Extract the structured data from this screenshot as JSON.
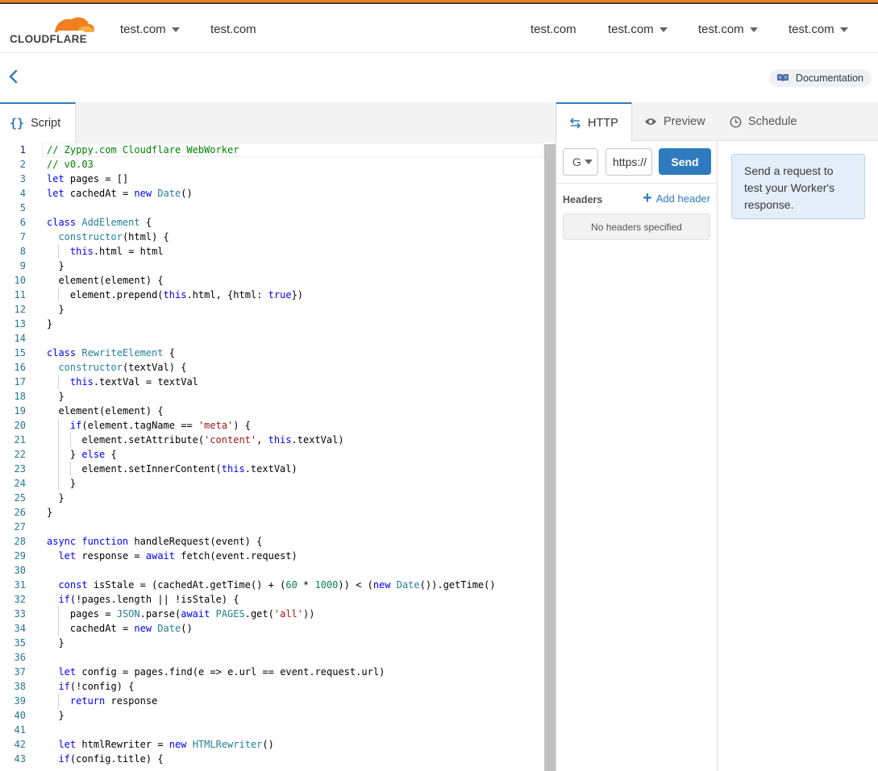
{
  "brand": {
    "name": "CLOUDFLARE",
    "accent": "#f38020",
    "primary": "#2f7bbf"
  },
  "topnav": {
    "left": [
      {
        "label": "test.com",
        "dropdown": true
      },
      {
        "label": "test.com",
        "dropdown": false
      }
    ],
    "right": [
      {
        "label": "test.com",
        "dropdown": false
      },
      {
        "label": "test.com",
        "dropdown": true
      },
      {
        "label": "test.com",
        "dropdown": true
      },
      {
        "label": "test.com",
        "dropdown": true
      }
    ]
  },
  "subbar": {
    "back_icon": "chevron-left-icon",
    "documentation_label": "Documentation",
    "documentation_icon": "book-icon"
  },
  "editor": {
    "tab_label": "Script",
    "tab_icon": "{}",
    "active_line": 1,
    "lines": [
      "// Zyppy.com Cloudflare WebWorker",
      "// v0.03",
      "let pages = []",
      "let cachedAt = new Date()",
      "",
      "class AddElement {",
      "  constructor(html) {",
      "    this.html = html",
      "  }",
      "  element(element) {",
      "    element.prepend(this.html, {html: true})",
      "  }",
      "}",
      "",
      "class RewriteElement {",
      "  constructor(textVal) {",
      "    this.textVal = textVal",
      "  }",
      "  element(element) {",
      "    if(element.tagName == 'meta') {",
      "      element.setAttribute('content', this.textVal)",
      "    } else {",
      "      element.setInnerContent(this.textVal)",
      "    }",
      "  }",
      "}",
      "",
      "async function handleRequest(event) {",
      "  let response = await fetch(event.request)",
      "",
      "  const isStale = (cachedAt.getTime() + (60 * 1000)) < (new Date()).getTime()",
      "  if(!pages.length || !isStale) {",
      "    pages = JSON.parse(await PAGES.get('all'))",
      "    cachedAt = new Date()",
      "  }",
      "",
      "  let config = pages.find(e => e.url == event.request.url)",
      "  if(!config) {",
      "    return response",
      "  }",
      "",
      "  let htmlRewriter = new HTMLRewriter()",
      "  if(config.title) {"
    ]
  },
  "preview": {
    "tabs": [
      {
        "label": "HTTP",
        "icon": "arrows-exchange-icon",
        "active": true
      },
      {
        "label": "Preview",
        "icon": "eye-icon",
        "active": false
      },
      {
        "label": "Schedule",
        "icon": "clock-icon",
        "active": false
      }
    ],
    "method_value": "G",
    "url_value": "https://",
    "send_label": "Send",
    "headers_label": "Headers",
    "add_header_label": "Add header",
    "no_headers_text": "No headers specified",
    "info_text": "Send a request to test your Worker's response."
  }
}
